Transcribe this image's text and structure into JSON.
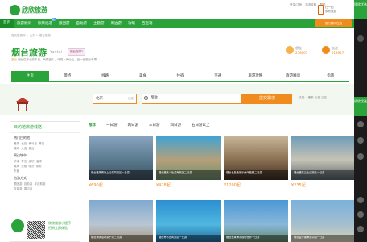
{
  "logo": {
    "name": "欣欣旅游",
    "url": "www.cncn.com"
  },
  "top_links": [
    "登录/注册",
    "旅游攻略",
    "帮助"
  ],
  "qr": {
    "line1": "扫一扫",
    "line2": "欣欣旅游"
  },
  "nav": {
    "items": [
      {
        "label": "首页",
        "active": true
      },
      {
        "label": "旅游顾问",
        "active": false
      },
      {
        "label": "欣欣优选",
        "active": false,
        "hot": "新"
      },
      {
        "label": "跟团游",
        "active": false
      },
      {
        "label": "自助游",
        "active": false
      },
      {
        "label": "主题游",
        "active": false
      },
      {
        "label": "周边游",
        "active": false
      },
      {
        "label": "攻略",
        "active": false
      },
      {
        "label": "百宝箱",
        "active": false
      }
    ],
    "right_button": "旅行顾问在线"
  },
  "breadcrumb": "首页旅游网 > 山东 > 烟台旅游",
  "destination": {
    "title": "烟台旅游",
    "en": "Yantai",
    "tag": "烟台在哪?",
    "desc_prefix": "烟台位于山东半岛，气候宜人，可观人间仙山，品一品烟台苹果",
    "weather": "多云",
    "stats": [
      {
        "label": "想去",
        "value": "258661"
      },
      {
        "label": "去过",
        "value": "518947"
      }
    ]
  },
  "tabs": [
    {
      "label": "主页",
      "active": true
    },
    {
      "label": "景点",
      "active": false
    },
    {
      "label": "线路",
      "active": false
    },
    {
      "label": "美食",
      "active": false
    },
    {
      "label": "住宿",
      "active": false
    },
    {
      "label": "交通",
      "active": false
    },
    {
      "label": "旅游攻略",
      "active": false
    },
    {
      "label": "旅游顾问",
      "active": false
    },
    {
      "label": "指南",
      "active": false
    }
  ],
  "search": {
    "city": "北京",
    "city_hint": "出发",
    "query": "烟台",
    "button": "提交需求",
    "hot_label": "热搜：",
    "hot_items": [
      "蓬莱",
      "长岛",
      "三亚"
    ]
  },
  "left_panel": {
    "title": "目的地旅游线路",
    "sections": [
      {
        "title": "热门目的地",
        "items": [
          "蓬莱",
          "长岛",
          "养马岛",
          "青岛",
          "威海",
          "大连",
          "烟台"
        ]
      },
      {
        "title": "周边城市",
        "items": [
          "济南",
          "青岛",
          "潍坊",
          "淄博",
          "威海",
          "日照",
          "临沂",
          "泰安",
          "东营"
        ]
      },
      {
        "title": "出游方式",
        "items": [
          "跟团游",
          "自助游",
          "半自助游",
          "自驾游",
          "周边游"
        ]
      }
    ],
    "promo": {
      "line1": "欣欣旅游小程序",
      "line2": "扫码立即体验"
    }
  },
  "filter_tabs": [
    {
      "label": "推荐",
      "active": true
    },
    {
      "label": "一日游",
      "active": false
    },
    {
      "label": "两日游",
      "active": false
    },
    {
      "label": "三日游",
      "active": false
    },
    {
      "label": "四日游",
      "active": false
    },
    {
      "label": "五日游以上",
      "active": false
    }
  ],
  "cards": [
    {
      "caption": "烟台蓬莱阁海上仙境风景区一日游",
      "price": "¥690起",
      "colors": [
        "#8aa5c0",
        "#5a7a8e",
        "#3e5060"
      ]
    },
    {
      "caption": "烟台蓬莱八仙过海景区二日游",
      "price": "¥428起",
      "colors": [
        "#3da3d4",
        "#b5a07a",
        "#6a8f6c"
      ]
    },
    {
      "caption": "烟台长岛渔家乐休闲度假二日游",
      "price": "¥1200起",
      "colors": [
        "#c9b79a",
        "#8a6f52",
        "#3e2e20"
      ]
    },
    {
      "caption": "烟台蓬莱三仙山景区一日游",
      "price": "¥235起",
      "colors": [
        "#6c9bb8",
        "#c7c3b5",
        "#55636c"
      ]
    },
    {
      "caption": "烟台海滨浴场亲子游三日游",
      "price": "",
      "colors": [
        "#7fa9cf",
        "#b8c6d4",
        "#a58e6c"
      ]
    },
    {
      "caption": "烟台养马岛风景区一日游",
      "price": "",
      "colors": [
        "#2b8fd0",
        "#4fb7e0",
        "#1c5f8f"
      ]
    },
    {
      "caption": "烟台蓬莱海洋极地世界一日游",
      "price": "",
      "colors": [
        "#4a98d5",
        "#89b8da",
        "#5a7f56"
      ]
    },
    {
      "caption": "烟台金沙滩海滨公园一日游",
      "price": "",
      "colors": [
        "#7bb1dc",
        "#a4bfcf",
        "#e0d2b0"
      ]
    }
  ],
  "sidebar": {
    "label": "欣欣优选",
    "label2": "欣欣优选"
  }
}
